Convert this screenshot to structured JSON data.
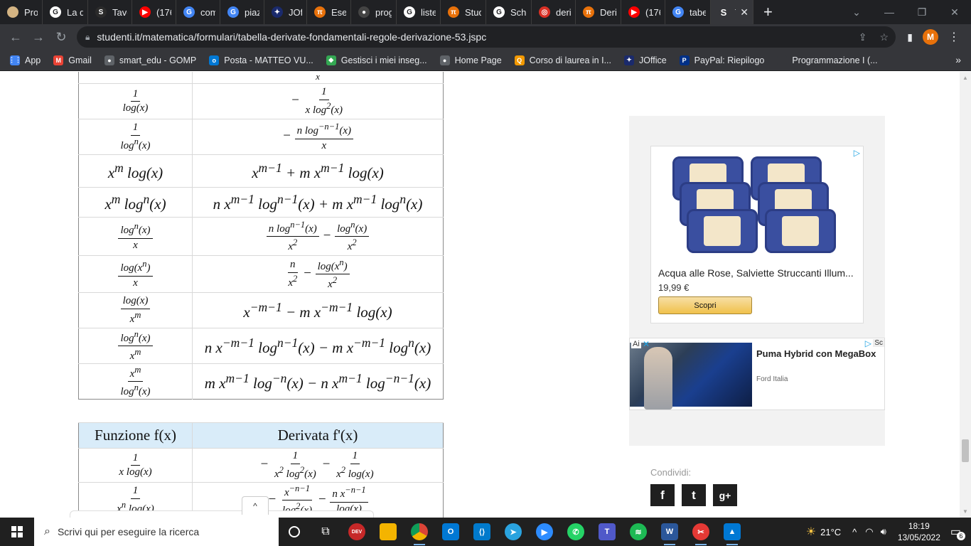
{
  "browser": {
    "tabs": [
      {
        "label": "Prov",
        "color": "#d4b483",
        "glyph": ""
      },
      {
        "label": "La d",
        "color": "#ffffff",
        "glyph": "G"
      },
      {
        "label": "Tavo",
        "color": "#2b2b2b",
        "glyph": "S"
      },
      {
        "label": "(176",
        "color": "#ff0000",
        "glyph": "▶"
      },
      {
        "label": "com",
        "color": "#4285f4",
        "glyph": "G"
      },
      {
        "label": "piaz",
        "color": "#4285f4",
        "glyph": "G"
      },
      {
        "label": "JOffi",
        "color": "#1a2a6c",
        "glyph": "✦"
      },
      {
        "label": "Eser",
        "color": "#e8710a",
        "glyph": "π"
      },
      {
        "label": "prog",
        "color": "#444444",
        "glyph": "●"
      },
      {
        "label": "liste",
        "color": "#ffffff",
        "glyph": "G"
      },
      {
        "label": "Stud",
        "color": "#e8710a",
        "glyph": "π"
      },
      {
        "label": "Sche",
        "color": "#ffffff",
        "glyph": "G"
      },
      {
        "label": "deriv",
        "color": "#d93025",
        "glyph": "◎"
      },
      {
        "label": "Deri",
        "color": "#e8710a",
        "glyph": "π"
      },
      {
        "label": "(176",
        "color": "#ff0000",
        "glyph": "▶"
      },
      {
        "label": "tabe",
        "color": "#4285f4",
        "glyph": "G"
      }
    ],
    "active_tab": {
      "label": "T",
      "glyph": "S"
    },
    "url": "studenti.it/matematica/formulari/tabella-derivate-fondamentali-regole-derivazione-53.jspc",
    "profile_initial": "M",
    "bookmarks": [
      {
        "label": "App",
        "color": "#4285f4",
        "glyph": "⋮⋮"
      },
      {
        "label": "Gmail",
        "color": "#ea4335",
        "glyph": "M"
      },
      {
        "label": "smart_edu - GOMP",
        "color": "#5f6368",
        "glyph": "●"
      },
      {
        "label": "Posta - MATTEO VU...",
        "color": "#0078d4",
        "glyph": "o"
      },
      {
        "label": "Gestisci i miei inseg...",
        "color": "#34a853",
        "glyph": "◆"
      },
      {
        "label": "Home Page",
        "color": "#5f6368",
        "glyph": "●"
      },
      {
        "label": "Corso di laurea in I...",
        "color": "#f29900",
        "glyph": "Q"
      },
      {
        "label": "JOffice",
        "color": "#1a2a6c",
        "glyph": "✦"
      },
      {
        "label": "PayPal: Riepilogo",
        "color": "#003087",
        "glyph": "P"
      },
      {
        "label": "Programmazione I (...",
        "color": "#35363a",
        "glyph": ""
      }
    ]
  },
  "page": {
    "table2_header": {
      "col1": "Funzione f(x)",
      "col2": "Derivata f'(x)"
    },
    "sidebar": {
      "ad1": {
        "choices": "▷",
        "product_name": "Acqua alle Rose, Salviette Struccanti Illum...",
        "price": "19,99 €",
        "button": "Scopri"
      },
      "ad2": {
        "label": "Ai",
        "close": "✕",
        "choices": "▷",
        "sc": "Sc",
        "title": "Puma Hybrid con MegaBox",
        "brand": "Ford Italia"
      },
      "share_label": "Condividi:",
      "share_buttons": [
        "f",
        "t",
        "g+"
      ]
    },
    "popup_toggle": "^"
  },
  "taskbar": {
    "search_placeholder": "Scrivi qui per eseguire la ricerca",
    "weather": "21°C",
    "time": "18:19",
    "date": "13/05/2022",
    "notifications": "6"
  }
}
